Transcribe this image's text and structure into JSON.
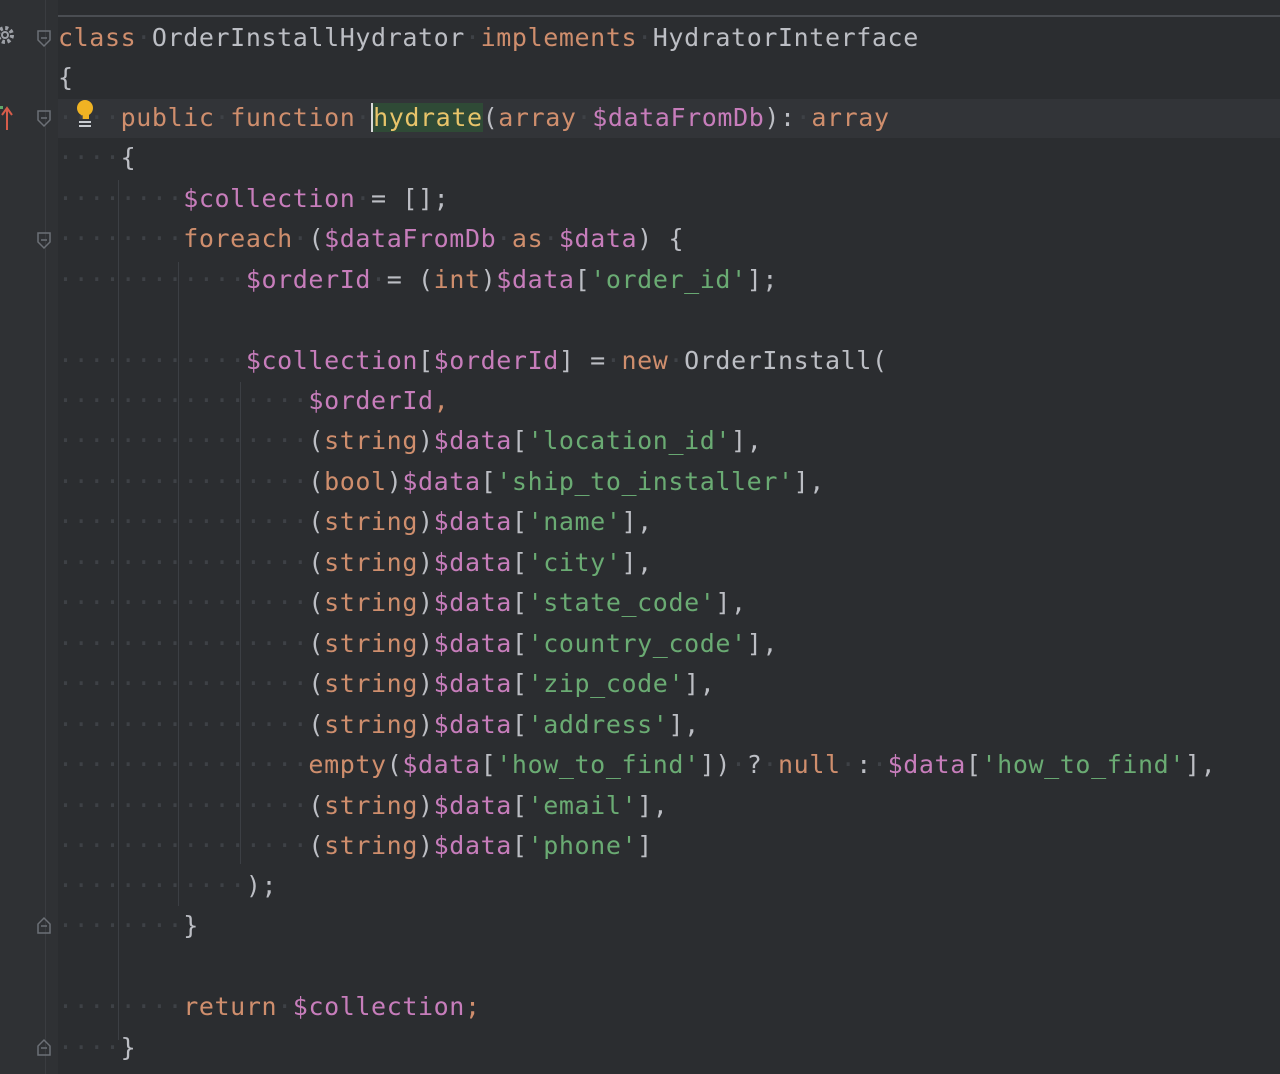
{
  "editor": {
    "language": "PHP",
    "highlighted_word": "hydrate",
    "colors": {
      "background": "#2b2d30",
      "keyword": "#cf8e6d",
      "variable": "#c77dbb",
      "string": "#6aab73",
      "text": "#bcbec4"
    }
  },
  "code": {
    "line1": {
      "kw1": "class",
      "name": "OrderInstallHydrator",
      "kw2": "implements",
      "iface": "HydratorInterface"
    },
    "line2": {
      "brace": "{"
    },
    "line3": {
      "kw1": "public",
      "kw2": "function",
      "fn": "hydrate",
      "p1": "(",
      "type1": "array",
      "param": "$dataFromDb",
      "p2": "):",
      "type2": "array"
    },
    "line4": {
      "brace": "{"
    },
    "line5": {
      "var": "$collection",
      "rest": "= [];"
    },
    "line6": {
      "kw": "foreach",
      "p1": "(",
      "v1": "$dataFromDb",
      "kw2": "as",
      "v2": "$data",
      "p2": ") {"
    },
    "line7": {
      "var": "$orderId",
      "eq": "= (",
      "cast": "int",
      "p": ")",
      "var2": "$data",
      "b1": "[",
      "str": "'order_id'",
      "b2": "];"
    },
    "line8": {
      "var": "$collection",
      "b1": "[",
      "var2": "$orderId",
      "b2": "] =",
      "kw": "new",
      "cls": "OrderInstall("
    },
    "line9": {
      "var": "$orderId",
      "p": ","
    },
    "args": [
      {
        "cast": "string",
        "key": "'location_id'",
        "end": "],"
      },
      {
        "cast": "bool",
        "key": "'ship_to_installer'",
        "end": "],"
      },
      {
        "cast": "string",
        "key": "'name'",
        "end": "],"
      },
      {
        "cast": "string",
        "key": "'city'",
        "end": "],"
      },
      {
        "cast": "string",
        "key": "'state_code'",
        "end": "],"
      },
      {
        "cast": "string",
        "key": "'country_code'",
        "end": "],"
      },
      {
        "cast": "string",
        "key": "'zip_code'",
        "end": "],"
      },
      {
        "cast": "string",
        "key": "'address'",
        "end": "],"
      }
    ],
    "line18": {
      "fn": "empty",
      "p1": "(",
      "v1": "$data",
      "b1": "[",
      "s1": "'how_to_find'",
      "b2": "])",
      "q": "?",
      "kw": "null",
      "c": ":",
      "v2": "$data",
      "b3": "[",
      "s2": "'how_to_find'",
      "b4": "],"
    },
    "line19": {
      "cast": "string",
      "key": "'email'",
      "end": "],"
    },
    "line20": {
      "cast": "string",
      "key": "'phone'",
      "end": "]"
    },
    "line21": {
      "p": ");"
    },
    "line22": {
      "brace": "}"
    },
    "line24": {
      "kw": "return",
      "var": "$collection",
      "p": ";"
    },
    "line25": {
      "brace": "}"
    },
    "common": {
      "data": "$data",
      "open": "(",
      "close": ")",
      "lb": "["
    }
  },
  "icons": {
    "settings": "gear-icon",
    "override": "override-arrow-icon",
    "intention": "lightbulb-icon",
    "fold": "fold-marker-icon"
  }
}
